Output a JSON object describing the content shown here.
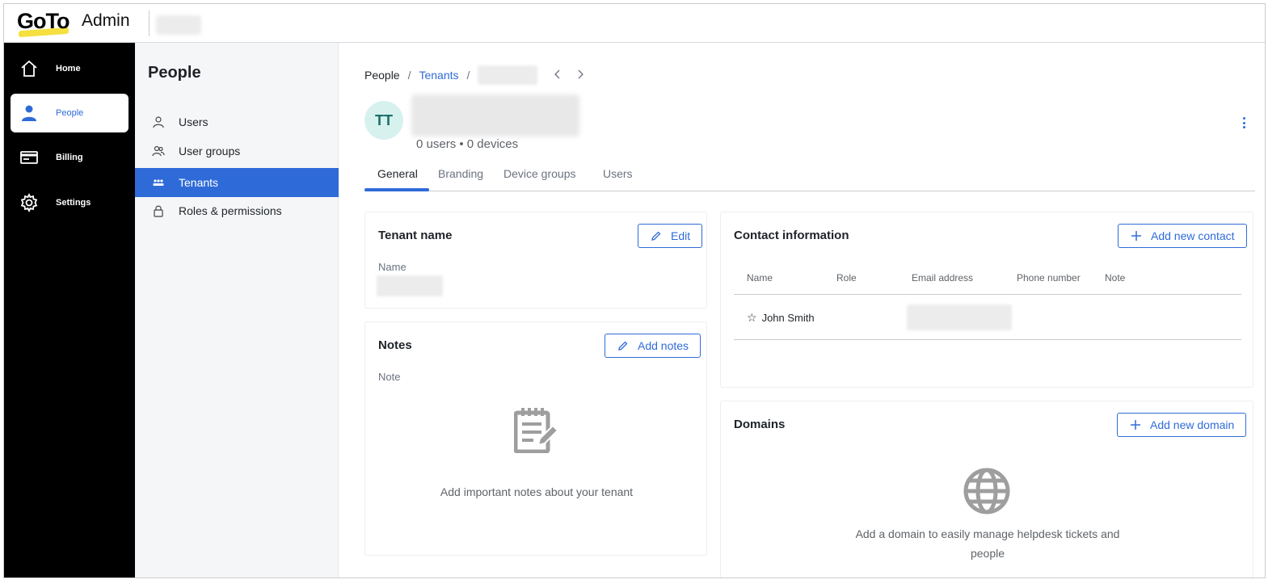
{
  "app": {
    "logo": "GoTo",
    "title": "Admin"
  },
  "leftnav": {
    "items": [
      {
        "label": "Home",
        "icon": "home-icon"
      },
      {
        "label": "People",
        "icon": "person-icon",
        "active": true
      },
      {
        "label": "Billing",
        "icon": "billing-icon"
      },
      {
        "label": "Settings",
        "icon": "gear-icon"
      }
    ]
  },
  "subnav": {
    "title": "People",
    "items": [
      {
        "label": "Users",
        "icon": "user-icon"
      },
      {
        "label": "User groups",
        "icon": "user-groups-icon"
      },
      {
        "label": "Tenants",
        "icon": "tenants-icon",
        "active": true
      },
      {
        "label": "Roles & permissions",
        "icon": "lock-icon"
      }
    ]
  },
  "breadcrumb": {
    "root": "People",
    "sep": "/",
    "parent": "Tenants"
  },
  "tenant": {
    "initials": "TT",
    "summary": "0 users • 0 devices"
  },
  "tabs": [
    "General",
    "Branding",
    "Device groups",
    "Users"
  ],
  "tenant_name_card": {
    "title": "Tenant name",
    "edit_label": "Edit",
    "name_label": "Name"
  },
  "notes_card": {
    "title": "Notes",
    "add_label": "Add notes",
    "note_label": "Note",
    "empty_text": "Add important notes about your tenant"
  },
  "contact_card": {
    "title": "Contact information",
    "add_label": "Add new contact",
    "columns": [
      "Name",
      "Role",
      "Email address",
      "Phone number",
      "Note"
    ],
    "rows": [
      {
        "name": "John Smith",
        "primary": true
      }
    ]
  },
  "domains_card": {
    "title": "Domains",
    "add_label": "Add new domain",
    "empty_text": "Add a domain to easily manage helpdesk tickets and people"
  },
  "colors": {
    "accent": "#2f6bd8",
    "nav_bg": "#000000",
    "avatar_bg": "#d7f1ef",
    "logo_yellow": "#f5e040"
  }
}
